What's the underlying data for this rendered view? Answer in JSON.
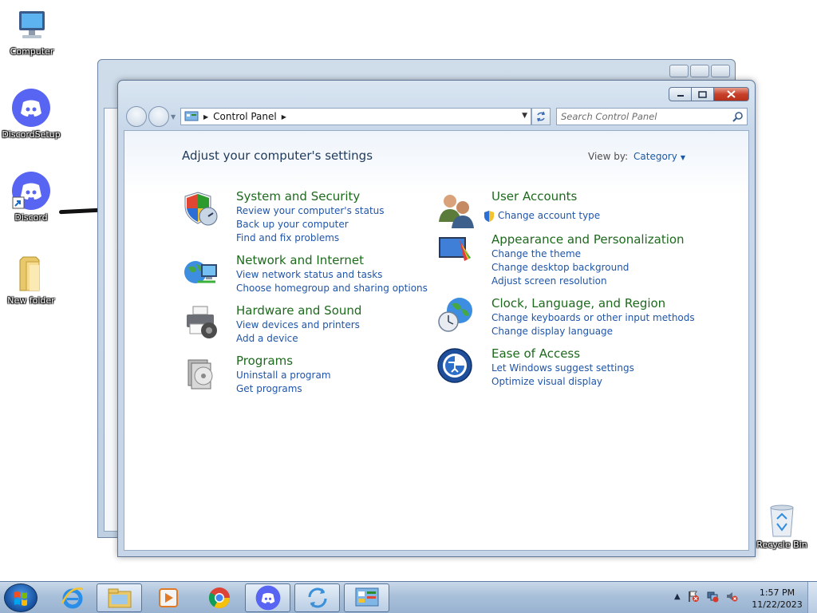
{
  "desktop": {
    "icons": [
      {
        "label": "Computer"
      },
      {
        "label": "DiscordSetup"
      },
      {
        "label": "Discord"
      },
      {
        "label": "New folder"
      },
      {
        "label": "Recycle Bin"
      }
    ]
  },
  "window": {
    "address": {
      "crumb": "Control Panel"
    },
    "search": {
      "placeholder": "Search Control Panel"
    },
    "heading": "Adjust your computer's settings",
    "view_by": {
      "label": "View by:",
      "value": "Category"
    },
    "categories_left": [
      {
        "title": "System and Security",
        "links": [
          "Review your computer's status",
          "Back up your computer",
          "Find and fix problems"
        ]
      },
      {
        "title": "Network and Internet",
        "links": [
          "View network status and tasks",
          "Choose homegroup and sharing options"
        ]
      },
      {
        "title": "Hardware and Sound",
        "links": [
          "View devices and printers",
          "Add a device"
        ]
      },
      {
        "title": "Programs",
        "links": [
          "Uninstall a program",
          "Get programs"
        ]
      }
    ],
    "categories_right": [
      {
        "title": "User Accounts",
        "links": [
          "Change account type"
        ]
      },
      {
        "title": "Appearance and Personalization",
        "links": [
          "Change the theme",
          "Change desktop background",
          "Adjust screen resolution"
        ]
      },
      {
        "title": "Clock, Language, and Region",
        "links": [
          "Change keyboards or other input methods",
          "Change display language"
        ]
      },
      {
        "title": "Ease of Access",
        "links": [
          "Let Windows suggest settings",
          "Optimize visual display"
        ]
      }
    ]
  },
  "taskbar": {
    "clock": {
      "time": "1:57 PM",
      "date": "11/22/2023"
    }
  }
}
